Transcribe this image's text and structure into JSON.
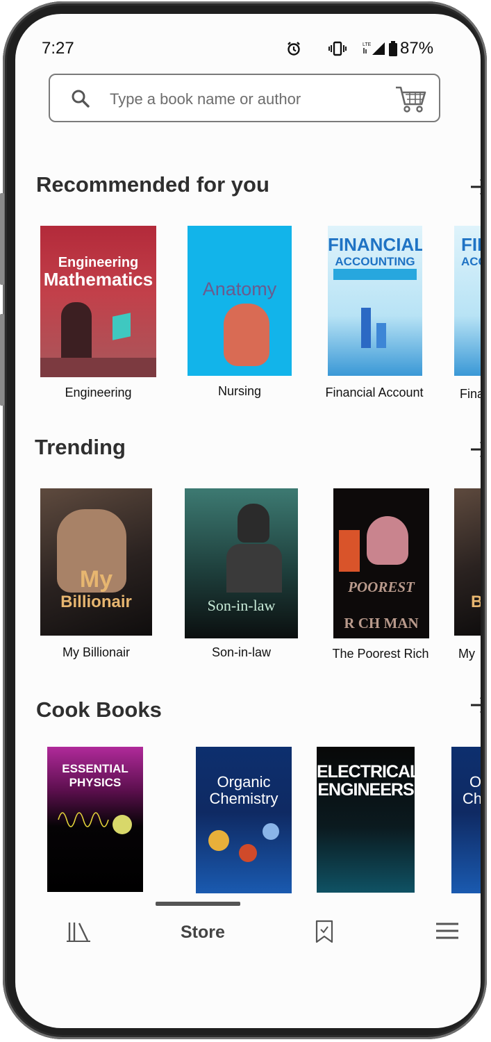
{
  "status": {
    "time": "7:27",
    "battery": "87%"
  },
  "search": {
    "placeholder": "Type a book name or author"
  },
  "sections": [
    {
      "title": "Recommended for you",
      "books": [
        {
          "label": "Engineering",
          "cover_title_1": "Engineering",
          "cover_title_2": "Mathematics"
        },
        {
          "label": "Nursing",
          "cover_title_1": "Anatomy"
        },
        {
          "label": "Financial Account",
          "cover_title_1": "FINANCIAL",
          "cover_title_2": "ACCOUNTING"
        },
        {
          "label": "Fina"
        }
      ]
    },
    {
      "title": "Trending",
      "books": [
        {
          "label": "My Billionair",
          "cover_title_1": "My",
          "cover_title_2": "Billionair"
        },
        {
          "label": "Son-in-law",
          "cover_title_1": "Son-in-law"
        },
        {
          "label": "The Poorest Rich",
          "cover_title_1": "POOREST",
          "cover_title_2": "R CH MAN"
        },
        {
          "label": "My"
        }
      ]
    },
    {
      "title": "Cook Books",
      "books": [
        {
          "cover_title_1": "ESSENTIAL",
          "cover_title_2": "PHYSICS"
        },
        {
          "cover_title_1": "Organic",
          "cover_title_2": "Chemistry"
        },
        {
          "cover_title_1": "ELECTRICAL",
          "cover_title_2": "ENGINEERS"
        },
        {
          "cover_title_1": "O",
          "cover_title_2": "Ch"
        }
      ]
    }
  ],
  "nav": {
    "store": "Store",
    "icons": [
      "library-icon",
      "bookmark-icon",
      "menu-icon"
    ]
  },
  "colors": {
    "text": "#2f2f2f",
    "accent": "#555555",
    "background": "#fcfcfc"
  }
}
